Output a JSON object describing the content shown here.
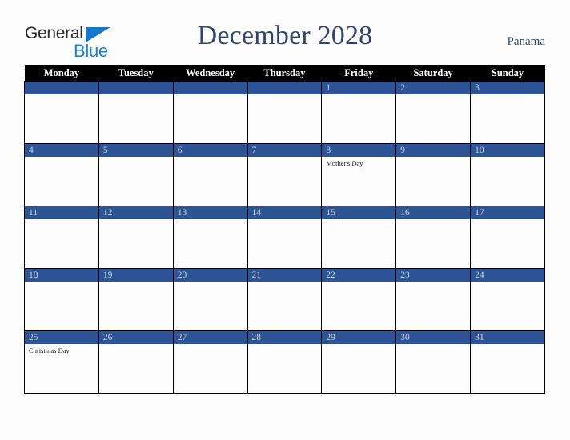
{
  "brand": {
    "name_part1": "General",
    "name_part2": "Blue",
    "triangle_icon": "blue-triangle-icon",
    "colors": {
      "general_text": "#2b2b2b",
      "blue_text": "#1a82d8",
      "triangle": "#1477cc"
    }
  },
  "header": {
    "title": "December 2028",
    "country": "Panama",
    "title_color": "#2f4470"
  },
  "calendar": {
    "month": "December",
    "year": "2028",
    "week_start": "Monday",
    "colors": {
      "header_bar": "#000000",
      "header_text": "#ffffff",
      "date_bar": "#2d5494",
      "date_text": "#ccd2dd",
      "cell_background": "#fdfdfd",
      "cell_border": "#000000",
      "event_text": "#1a1a1a"
    },
    "weekday_headers": [
      "Monday",
      "Tuesday",
      "Wednesday",
      "Thursday",
      "Friday",
      "Saturday",
      "Sunday"
    ],
    "weeks": [
      [
        {
          "day": "",
          "events": []
        },
        {
          "day": "",
          "events": []
        },
        {
          "day": "",
          "events": []
        },
        {
          "day": "",
          "events": []
        },
        {
          "day": "1",
          "events": []
        },
        {
          "day": "2",
          "events": []
        },
        {
          "day": "3",
          "events": []
        }
      ],
      [
        {
          "day": "4",
          "events": []
        },
        {
          "day": "5",
          "events": []
        },
        {
          "day": "6",
          "events": []
        },
        {
          "day": "7",
          "events": []
        },
        {
          "day": "8",
          "events": [
            "Mother's Day"
          ]
        },
        {
          "day": "9",
          "events": []
        },
        {
          "day": "10",
          "events": []
        }
      ],
      [
        {
          "day": "11",
          "events": []
        },
        {
          "day": "12",
          "events": []
        },
        {
          "day": "13",
          "events": []
        },
        {
          "day": "14",
          "events": []
        },
        {
          "day": "15",
          "events": []
        },
        {
          "day": "16",
          "events": []
        },
        {
          "day": "17",
          "events": []
        }
      ],
      [
        {
          "day": "18",
          "events": []
        },
        {
          "day": "19",
          "events": []
        },
        {
          "day": "20",
          "events": []
        },
        {
          "day": "21",
          "events": []
        },
        {
          "day": "22",
          "events": []
        },
        {
          "day": "23",
          "events": []
        },
        {
          "day": "24",
          "events": []
        }
      ],
      [
        {
          "day": "25",
          "events": [
            "Christmas Day"
          ]
        },
        {
          "day": "26",
          "events": []
        },
        {
          "day": "27",
          "events": []
        },
        {
          "day": "28",
          "events": []
        },
        {
          "day": "29",
          "events": []
        },
        {
          "day": "30",
          "events": []
        },
        {
          "day": "31",
          "events": []
        }
      ]
    ]
  }
}
